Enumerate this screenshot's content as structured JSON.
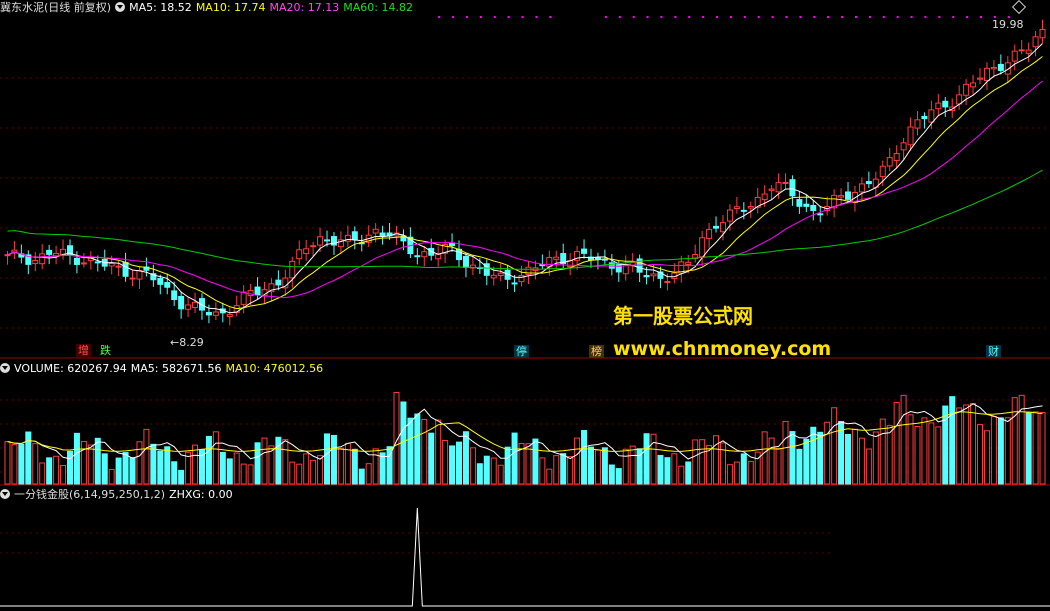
{
  "header": {
    "title": "冀东水泥(日线 前复权)",
    "ma5": "MA5: 18.52",
    "ma10": "MA10: 17.74",
    "ma20": "MA20: 17.13",
    "ma60": "MA60: 14.82",
    "high_label": "19.98",
    "low_label": "8.29"
  },
  "volume_header": {
    "volume": "VOLUME: 620267.94",
    "ma5": "MA5: 582671.56",
    "ma10": "MA10: 476012.56"
  },
  "indicator_header": {
    "name": "一分钱金股(6,14,95,250,1,2)",
    "value": "ZHXG: 0.00"
  },
  "markers": [
    "增",
    "跌",
    "停",
    "榜",
    "财"
  ],
  "watermark": {
    "line1": "第一股票公式网",
    "line2": "www.chnmoney.com"
  },
  "colors": {
    "up": "#ff3c3c",
    "down": "#54ffff",
    "ma5": "#ffffff",
    "ma10": "#ffff00",
    "ma20": "#ff00ff",
    "ma60": "#00cc00",
    "divider": "#a00000"
  },
  "chart_data": {
    "type": "candlestick",
    "price_range": [
      8.29,
      19.98
    ],
    "close_path": [
      10.8,
      10.9,
      10.7,
      11.0,
      10.9,
      10.8,
      10.6,
      10.5,
      10.3,
      10.2,
      10.1,
      9.6,
      9.1,
      8.8,
      8.6,
      8.5,
      8.9,
      9.3,
      9.5,
      9.8,
      10.4,
      11.2,
      11.6,
      11.5,
      11.4,
      11.6,
      11.9,
      11.7,
      11.3,
      11.0,
      10.9,
      11.2,
      10.8,
      10.4,
      10.1,
      9.9,
      10.1,
      10.3,
      10.6,
      10.8,
      10.9,
      10.8,
      10.6,
      10.5,
      10.4,
      10.1,
      10.0,
      10.2,
      10.5,
      11.6,
      12.2,
      12.5,
      12.8,
      13.2,
      13.8,
      13.5,
      13.0,
      12.6,
      12.9,
      13.3,
      13.6,
      13.9,
      14.4,
      15.5,
      16.2,
      16.6,
      16.9,
      17.3,
      17.8,
      18.2,
      18.6,
      18.9,
      19.2,
      19.98
    ],
    "ma_last": {
      "MA5": 18.52,
      "MA10": 17.74,
      "MA20": 17.13,
      "MA60": 14.82
    },
    "volume_last": {
      "VOLUME": 620267.94,
      "MA5": 582671.56,
      "MA10": 476012.56
    },
    "indicator_last": {
      "ZHXG": 0.0
    }
  }
}
